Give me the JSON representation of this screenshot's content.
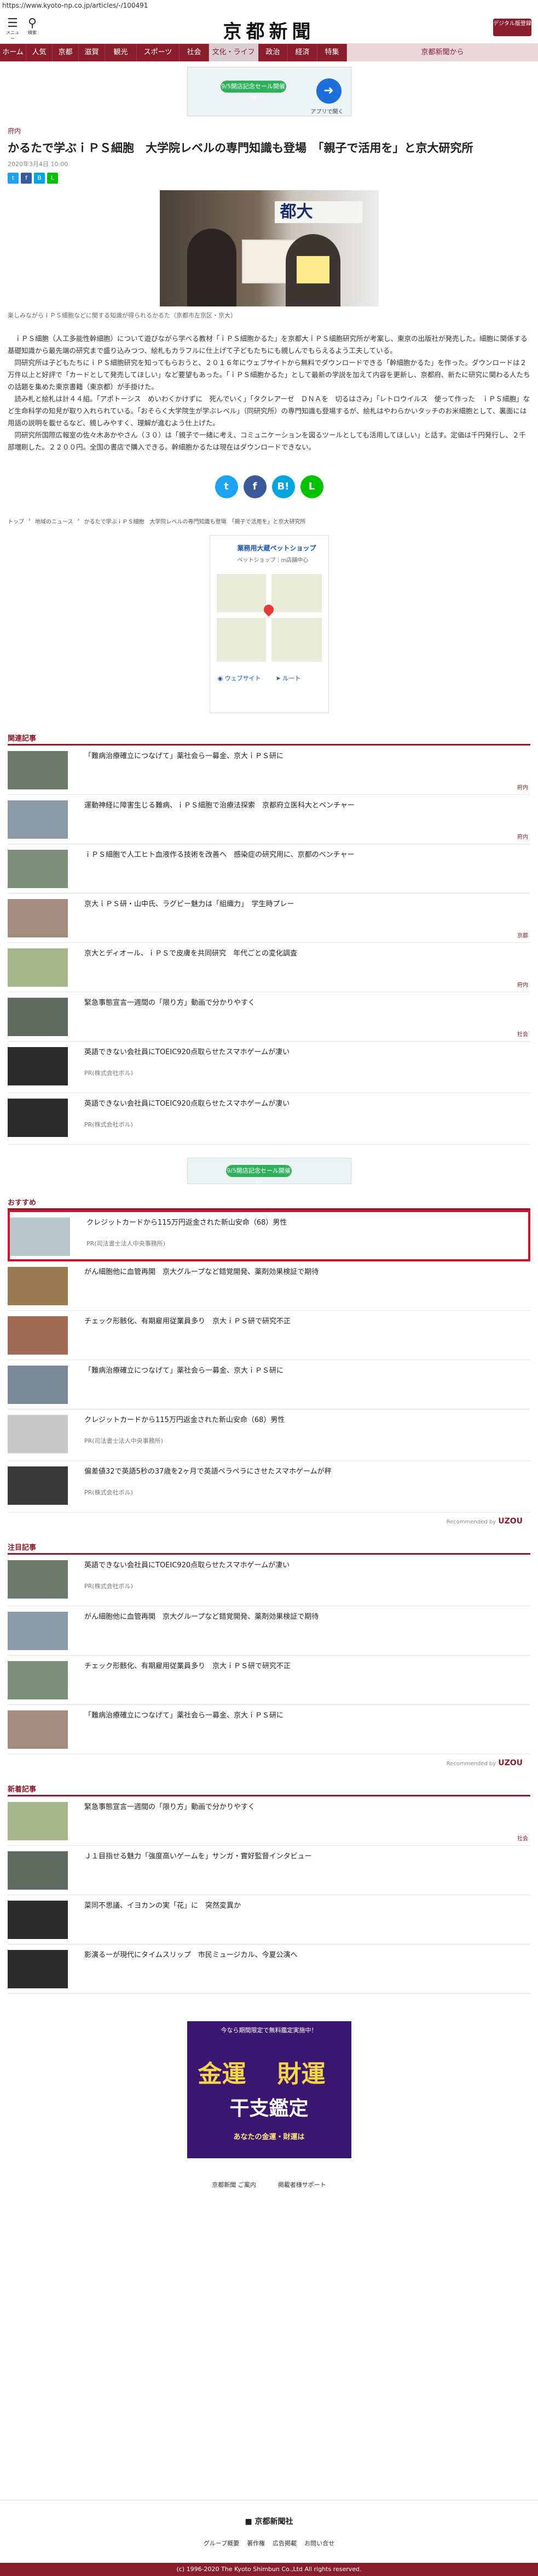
{
  "url": "https://www.kyoto-np.co.jp/articles/-/100491",
  "header": {
    "menu_icon_label": "メニュー",
    "search_icon_label": "検索",
    "logo": "京都新聞",
    "register_button": "デジタル版登録"
  },
  "nav": [
    "ホーム",
    "人気",
    "京都",
    "滋賀",
    "観光",
    "スポーツ",
    "社会",
    "文化・ライフ",
    "政治",
    "経済",
    "特集",
    "京都新聞から"
  ],
  "nav_active": "文化・ライフ",
  "top_ad": {
    "pill": "9/5開店記念セール開催中",
    "sub": "アプリで開く"
  },
  "article": {
    "category": "府内",
    "title": "かるたで学ぶｉＰＳ細胞　大学院レベルの専門知識も登場　「親子で活用を」と京大研究所",
    "date": "2020年3月4日 10:00",
    "photo_sign": "都大",
    "caption": "楽しみながらｉＰＳ細胞などに関する知識が得られるかるた（京都市左京区・京大）",
    "paragraphs": [
      "ｉＰＳ細胞（人工多能性幹細胞）について遊びながら学べる教材「ｉＰＳ細胞かるた」を京都大ｉＰＳ細胞研究所が考案し、東京の出版社が発売した。細胞に関係する基礎知識から最先端の研究まで盛り込みつつ、絵札もカラフルに仕上げて子どもたちにも親しんでもらえるよう工夫している。",
      "同研究所は子どもたちにｉＰＳ細胞研究を知ってもらおうと、２０１６年にウェブサイトから無料でダウンロードできる「幹細胞かるた」を作った。ダウンロードは２万件以上と好評で「カードとして発売してほしい」など要望もあった。「ｉＰＳ細胞かるた」として最新の学説を加えて内容を更新し、京都府、新たに研究に関わる人たちの話題を集めた東京書籍（東京都）が手掛けた。",
      "読み札と絵札は計４４組。「アポトーシス　めいわくかけずに　死んでいく」「タクレアーゼ　ＤＮＡを　切るはさみ」「レトロウイルス　使って作った　ｉＰＳ細胞」など生命科学の知見が取り入れられている。「おそらく大学院生が学ぶレベル」（同研究所）の専門知識も登場するが、絵札はやわらかいタッチのお米細胞として、裏面には用語の説明を載せるなど、親しみやすく、理解が進むよう仕上げた。",
      "同研究所国際広報室の佐々木あかやさん（３０）は「親子で一緒に考え、コミュニケーションを図るツールとしても活用してほしい」と話す。定価は千円発行し、２千部増刷した。２２００円。全国の書店で購入できる。幹細胞かるたは現在はダウンロードできない。"
    ]
  },
  "breadcrumb": [
    "トップ",
    "地域のニュース",
    "かるたで学ぶｉＰＳ細胞　大学院レベルの専門知識も登場　「親子で活用を」と京大研究所"
  ],
  "map_ad": {
    "title": "業務用大蔵ペットショップ",
    "line": "ペットショップ｜m店舗中心",
    "sub1": "ウェブサイト",
    "sub2": "ルート"
  },
  "related": {
    "heading": "関連記事",
    "items": [
      {
        "text": "「難病治療確立につなげて」薬社会ら一募金、京大ｉＰＳ研に",
        "tag": "府内"
      },
      {
        "text": "運動神経に障害生じる難病、ｉＰＳ細胞で治療法探索　京都府立医科大とベンチャー",
        "tag": "府内"
      },
      {
        "text": "ｉＰＳ細胞で人工ヒト血液作る技術を改善へ　感染症の研究用に、京都のベンチャー",
        "tag": ""
      },
      {
        "text": "京大ｉＰＳ研・山中氏、ラグビー魅力は「組織力」　学生時プレー",
        "tag": "京都"
      },
      {
        "text": "京大とディオール、ｉＰＳで皮膚を共同研究　年代ごとの変化調査",
        "tag": "府内"
      },
      {
        "text": "緊急事態宣言一週間の「限り方」動画で分かりやすく",
        "tag": "社会"
      },
      {
        "text": "英語できない会社員にTOEIC920点取らせたスマホゲームが凄い",
        "pr": "PR(株式会社ボル)"
      },
      {
        "text": "英語できない会社員にTOEIC920点取らせたスマホゲームが凄い",
        "pr": "PR(株式会社ボル)"
      }
    ]
  },
  "recommend": {
    "heading": "おすすめ",
    "items": [
      {
        "text": "クレジットカードから115万円返金された新山安命（68）男性",
        "pr": "PR(司法書士法人中央事務所)"
      },
      {
        "text": "がん細胞他に血管再開　京大グループなど錯覚開発、薬剤効果検証で期待",
        "tag": ""
      },
      {
        "text": "チェック形骸化、有期雇用従業員多り　京大ｉＰＳ研で研究不正",
        "tag": ""
      },
      {
        "text": "「難病治療確立につなげて」薬社会ら一募金、京大ｉＰＳ研に",
        "tag": ""
      },
      {
        "text": "クレジットカードから115万円返金された新山安命（68）男性",
        "pr": "PR(司法書士法人中央事務所)"
      },
      {
        "text": "偏差値32で英語5秒の37歳を2ヶ月で英語ペラペラにさせたスマホゲームが秤",
        "pr": "PR(株式会社ボル)"
      }
    ],
    "powered": "Recommended by"
  },
  "attention": {
    "heading": "注目記事",
    "items": [
      {
        "text": "英語できない会社員にTOEIC920点取らせたスマホゲームが凄い",
        "pr": "PR(株式会社ボル)"
      },
      {
        "text": "がん細胞他に血管再開　京大グループなど錯覚開発、薬剤効果検証で期待",
        "tag": ""
      },
      {
        "text": "チェック形骸化、有期雇用従業員多り　京大ｉＰＳ研で研究不正",
        "tag": ""
      },
      {
        "text": "「難病治療確立につなげて」薬社会ら一募金、京大ｉＰＳ研に",
        "tag": ""
      }
    ],
    "powered": "Recommended by"
  },
  "latest": {
    "heading": "新着記事",
    "items": [
      {
        "text": "緊急事態宣言一週間の「限り方」動画で分かりやすく",
        "tag": "社会"
      },
      {
        "text": "Ｊ１目指せる魅力「強度高いゲームを」サンガ・實好監督インタビュー",
        "tag": ""
      },
      {
        "text": "菜同不思議、イヨカンの実「花」に　突然変異か",
        "tag": ""
      },
      {
        "text": "影演るーが現代にタイムスリップ　市民ミュージカル、今夏公演へ",
        "tag": ""
      }
    ]
  },
  "bottom_ad": {
    "top": "今なら期間限定で無料鑑定実施中！",
    "main1": "金運",
    "main2": "財運",
    "main3": "干支鑑定",
    "sub": "あなたの金運・財運は"
  },
  "footer_links": [
    "京都新聞 ご案内",
    "掲載者様サポート"
  ],
  "footer_brand": "京都新聞社",
  "footer_nav": [
    "グループ概要",
    "著作権",
    "広告掲載",
    "お問い合せ"
  ],
  "copyright": "(c) 1996-2020 The Kyoto Shimbun Co.,Ltd All rights reserved.",
  "unicorn": "UZOU",
  "colors": {
    "brand": "#8a1d2c",
    "highlight": "#d0112b"
  }
}
